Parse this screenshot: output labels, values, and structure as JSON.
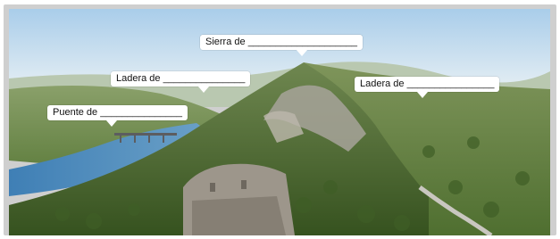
{
  "labels": {
    "sierra": "Sierra de ____________________",
    "ladera_izq": "Ladera de _______________",
    "ladera_der": "Ladera de ________________",
    "puente": "Puente de _______________"
  },
  "photo": {
    "description_icon": "landscape-photo",
    "colors": {
      "sky": "#cfe3f4",
      "river": "#4e88b8",
      "forest": "#4f6e35",
      "rock": "#a7a39a"
    }
  }
}
